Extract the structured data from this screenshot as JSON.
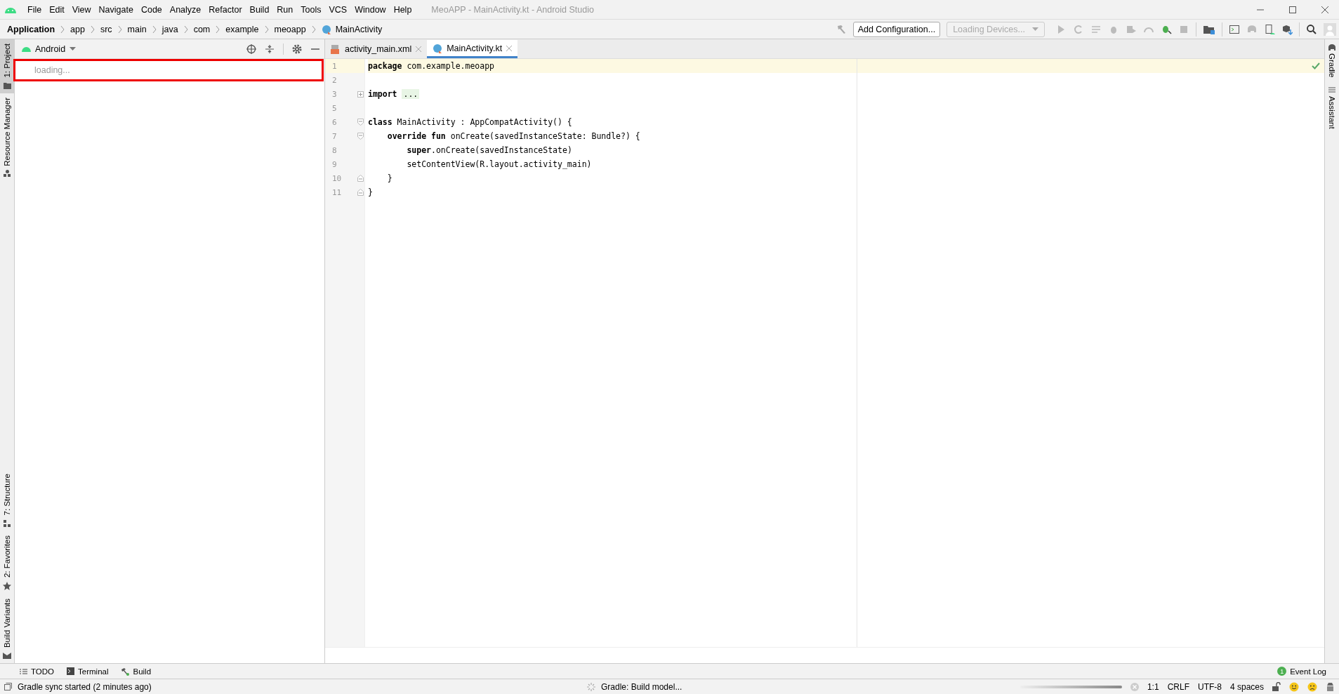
{
  "window": {
    "title": "MeoAPP - MainActivity.kt - Android Studio"
  },
  "menu": [
    "File",
    "Edit",
    "View",
    "Navigate",
    "Code",
    "Analyze",
    "Refactor",
    "Build",
    "Run",
    "Tools",
    "VCS",
    "Window",
    "Help"
  ],
  "breadcrumbs": [
    {
      "label": "Application",
      "kind": "project"
    },
    {
      "label": "app",
      "kind": "folder"
    },
    {
      "label": "src",
      "kind": "folder"
    },
    {
      "label": "main",
      "kind": "folder"
    },
    {
      "label": "java",
      "kind": "folder"
    },
    {
      "label": "com",
      "kind": "folder"
    },
    {
      "label": "example",
      "kind": "folder"
    },
    {
      "label": "meoapp",
      "kind": "folder"
    },
    {
      "label": "MainActivity",
      "kind": "class"
    }
  ],
  "toolbar": {
    "configuration": "Add Configuration...",
    "devices": "Loading Devices..."
  },
  "left_strip_top": [
    {
      "label": "1: Project",
      "kind": "project",
      "selected": true
    },
    {
      "label": "Resource Manager",
      "kind": "resources",
      "selected": false
    }
  ],
  "left_strip_bottom": [
    {
      "label": "7: Structure",
      "kind": "structure",
      "selected": false
    },
    {
      "label": "2: Favorites",
      "kind": "favorites",
      "selected": false
    },
    {
      "label": "Build Variants",
      "kind": "variants",
      "selected": false
    }
  ],
  "project_panel": {
    "view": "Android",
    "status": "loading..."
  },
  "editor": {
    "tabs": [
      {
        "label": "activity_main.xml",
        "kind": "xml",
        "selected": false
      },
      {
        "label": "MainActivity.kt",
        "kind": "kotlin",
        "selected": true
      }
    ],
    "lines": [
      {
        "number": "1",
        "text": "**package** com.example.meoapp",
        "kind": "plain",
        "current": true
      },
      {
        "number": "2",
        "kind": "plain",
        "current": false
      },
      {
        "number": "3",
        "text": "**import** ",
        "folded": "...",
        "kind": "expand",
        "current": false
      },
      {
        "number": "5",
        "kind": "plain",
        "current": false
      },
      {
        "number": "6",
        "text": "**class** MainActivity : AppCompatActivity() {",
        "kind": "collapse",
        "current": false
      },
      {
        "number": "7",
        "text": "    **override fun** onCreate(savedInstanceState: Bundle?) {",
        "kind": "collapse",
        "current": false
      },
      {
        "number": "8",
        "text": "        **super**.onCreate(savedInstanceState)",
        "kind": "plain",
        "current": false
      },
      {
        "number": "9",
        "text": "        setContentView(R.layout.activity_main)",
        "kind": "plain",
        "current": false
      },
      {
        "number": "10",
        "text": "    }",
        "kind": "block_end",
        "current": false
      },
      {
        "number": "11",
        "text": "}",
        "kind": "block_end",
        "current": false
      }
    ]
  },
  "right_strip": [
    {
      "label": "Gradle",
      "kind": "gradle",
      "selected": false
    },
    {
      "label": "Assistant",
      "kind": "assistant",
      "selected": false
    }
  ],
  "bottom_tools": [
    {
      "label": "TODO",
      "kind": "todo"
    },
    {
      "label": "Terminal",
      "kind": "terminal"
    },
    {
      "label": "Build",
      "kind": "build"
    }
  ],
  "event_log": {
    "badge": "1",
    "label": "Event Log"
  },
  "status": {
    "level": 1,
    "message": "Gradle sync started (2 minutes ago)",
    "task": "Gradle: Build model...",
    "position": "1:1",
    "line_separator": "CRLF",
    "encoding": "UTF-8",
    "indent": "4 spaces"
  }
}
